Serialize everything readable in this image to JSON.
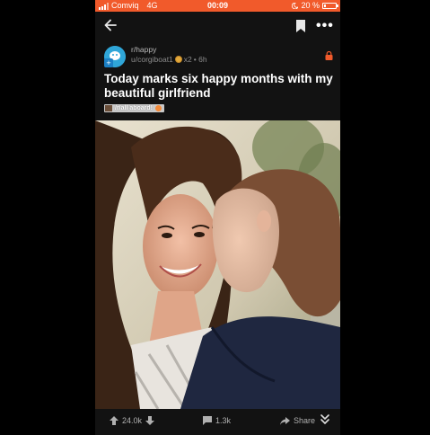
{
  "status_bar": {
    "carrier": "Comviq",
    "network": "4G",
    "time": "00:09",
    "battery_percent": "20 %",
    "battery_level": 0.2,
    "accent_color": "#f15a2b"
  },
  "nav": {
    "back_icon": "arrow-left-icon",
    "save_icon": "bookmark-icon",
    "more_icon": "more-horizontal-icon"
  },
  "post": {
    "subreddit": "r/happy",
    "author": "u/corgiboat1",
    "awards": "x2",
    "age": "• 6h",
    "title": "Today marks six happy months with my beautiful girlfriend",
    "flair": "/r/all aboard!",
    "locked_icon": "lock-icon",
    "image_alt": "Photo of two women, one kissing the other's cheek"
  },
  "actions": {
    "upvotes": "24.0k",
    "comments": "1.3k",
    "share": "Share"
  }
}
